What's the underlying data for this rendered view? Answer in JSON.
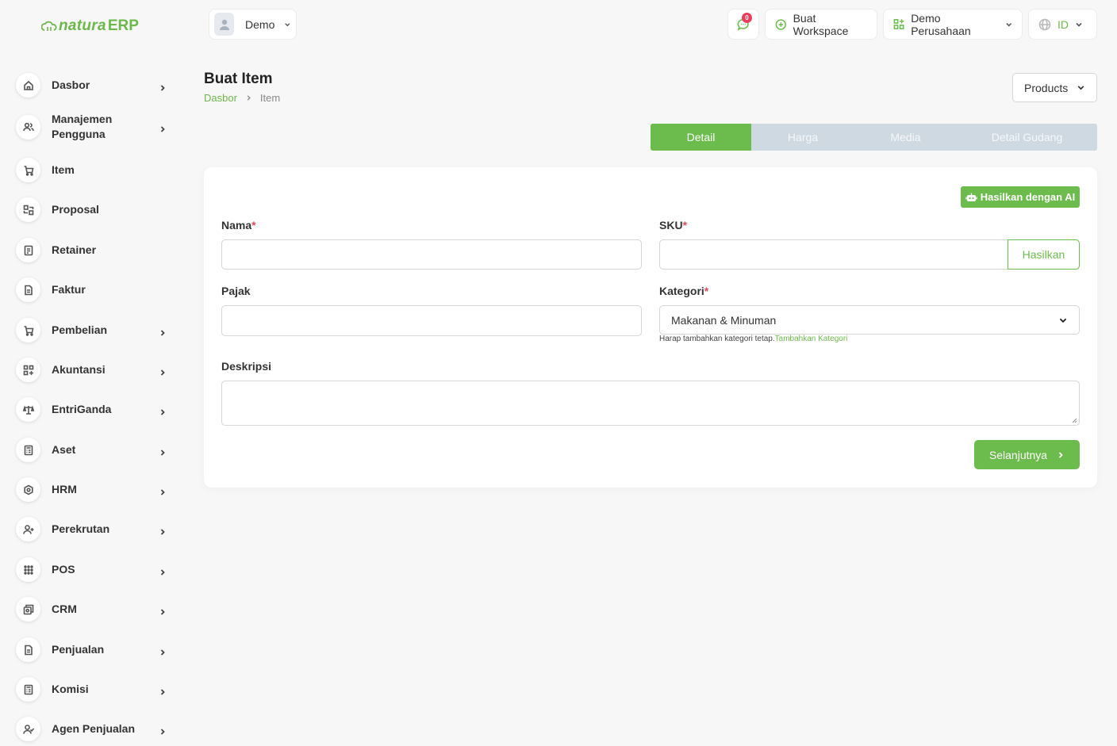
{
  "brand": {
    "name": "natura",
    "suffix": "ERP"
  },
  "topbar": {
    "user_label": "Demo",
    "notification_count": "0",
    "create_workspace": "Buat Workspace",
    "company": "Demo Perusahaan",
    "language": "ID"
  },
  "sidebar": {
    "items": [
      {
        "label": "Dasbor",
        "icon": "home-icon"
      },
      {
        "label": "Manajemen Pengguna",
        "icon": "users-icon"
      },
      {
        "label": "Item",
        "icon": "cart-icon"
      },
      {
        "label": "Proposal",
        "icon": "proposal-icon"
      },
      {
        "label": "Retainer",
        "icon": "retainer-icon"
      },
      {
        "label": "Faktur",
        "icon": "invoice-icon"
      },
      {
        "label": "Pembelian",
        "icon": "purchase-icon"
      },
      {
        "label": "Akuntansi",
        "icon": "accounting-icon"
      },
      {
        "label": "EntriGanda",
        "icon": "scale-icon"
      },
      {
        "label": "Aset",
        "icon": "asset-icon"
      },
      {
        "label": "HRM",
        "icon": "hrm-icon"
      },
      {
        "label": "Perekrutan",
        "icon": "user-plus-icon"
      },
      {
        "label": "POS",
        "icon": "grid-dots-icon"
      },
      {
        "label": "CRM",
        "icon": "crm-icon"
      },
      {
        "label": "Penjualan",
        "icon": "sales-icon"
      },
      {
        "label": "Komisi",
        "icon": "calculator-icon"
      },
      {
        "label": "Agen Penjualan",
        "icon": "user-check-icon"
      }
    ]
  },
  "page": {
    "title": "Buat Item",
    "breadcrumb_home": "Dasbor",
    "breadcrumb_current": "Item",
    "type_select": "Products"
  },
  "tabs": [
    "Detail",
    "Harga",
    "Media",
    "Detail Gudang"
  ],
  "form": {
    "ai_button": "Hasilkan dengan AI",
    "name_label": "Nama",
    "sku_label": "SKU",
    "generate_button": "Hasilkan",
    "tax_label": "Pajak",
    "category_label": "Kategori",
    "category_value": "Makanan & Minuman",
    "category_hint": "Harap tambahkan kategori tetap.",
    "category_hint_link": "Tambahkan Kategori",
    "description_label": "Deskripsi",
    "required_mark": "*",
    "next_button": "Selanjutnya"
  },
  "colors": {
    "accent": "#6cbb4d",
    "required": "#e34a5c",
    "tab_bg": "#cfd9e1"
  }
}
